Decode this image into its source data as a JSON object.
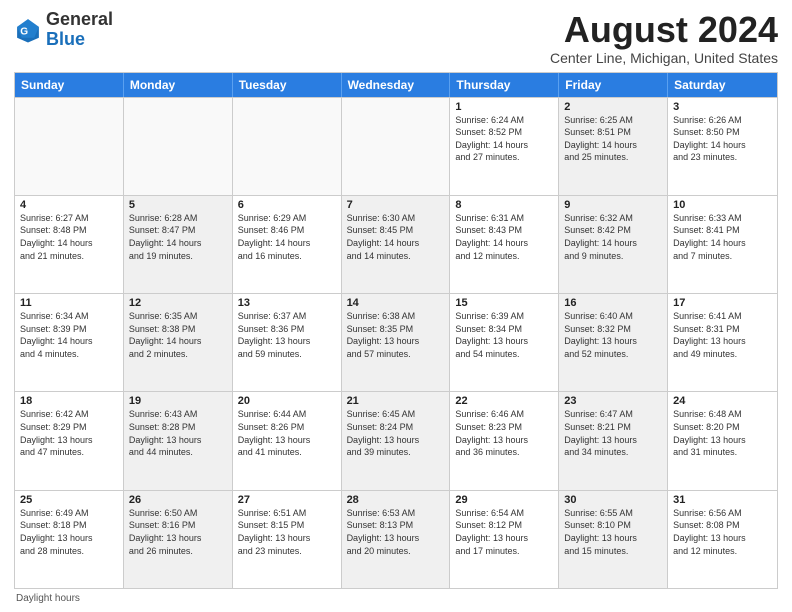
{
  "header": {
    "logo_general": "General",
    "logo_blue": "Blue",
    "month_year": "August 2024",
    "location": "Center Line, Michigan, United States"
  },
  "weekdays": [
    "Sunday",
    "Monday",
    "Tuesday",
    "Wednesday",
    "Thursday",
    "Friday",
    "Saturday"
  ],
  "rows": [
    [
      {
        "day": "",
        "info": "",
        "shaded": false,
        "empty": true
      },
      {
        "day": "",
        "info": "",
        "shaded": false,
        "empty": true
      },
      {
        "day": "",
        "info": "",
        "shaded": false,
        "empty": true
      },
      {
        "day": "",
        "info": "",
        "shaded": false,
        "empty": true
      },
      {
        "day": "1",
        "info": "Sunrise: 6:24 AM\nSunset: 8:52 PM\nDaylight: 14 hours\nand 27 minutes.",
        "shaded": false,
        "empty": false
      },
      {
        "day": "2",
        "info": "Sunrise: 6:25 AM\nSunset: 8:51 PM\nDaylight: 14 hours\nand 25 minutes.",
        "shaded": true,
        "empty": false
      },
      {
        "day": "3",
        "info": "Sunrise: 6:26 AM\nSunset: 8:50 PM\nDaylight: 14 hours\nand 23 minutes.",
        "shaded": false,
        "empty": false
      }
    ],
    [
      {
        "day": "4",
        "info": "Sunrise: 6:27 AM\nSunset: 8:48 PM\nDaylight: 14 hours\nand 21 minutes.",
        "shaded": false,
        "empty": false
      },
      {
        "day": "5",
        "info": "Sunrise: 6:28 AM\nSunset: 8:47 PM\nDaylight: 14 hours\nand 19 minutes.",
        "shaded": true,
        "empty": false
      },
      {
        "day": "6",
        "info": "Sunrise: 6:29 AM\nSunset: 8:46 PM\nDaylight: 14 hours\nand 16 minutes.",
        "shaded": false,
        "empty": false
      },
      {
        "day": "7",
        "info": "Sunrise: 6:30 AM\nSunset: 8:45 PM\nDaylight: 14 hours\nand 14 minutes.",
        "shaded": true,
        "empty": false
      },
      {
        "day": "8",
        "info": "Sunrise: 6:31 AM\nSunset: 8:43 PM\nDaylight: 14 hours\nand 12 minutes.",
        "shaded": false,
        "empty": false
      },
      {
        "day": "9",
        "info": "Sunrise: 6:32 AM\nSunset: 8:42 PM\nDaylight: 14 hours\nand 9 minutes.",
        "shaded": true,
        "empty": false
      },
      {
        "day": "10",
        "info": "Sunrise: 6:33 AM\nSunset: 8:41 PM\nDaylight: 14 hours\nand 7 minutes.",
        "shaded": false,
        "empty": false
      }
    ],
    [
      {
        "day": "11",
        "info": "Sunrise: 6:34 AM\nSunset: 8:39 PM\nDaylight: 14 hours\nand 4 minutes.",
        "shaded": false,
        "empty": false
      },
      {
        "day": "12",
        "info": "Sunrise: 6:35 AM\nSunset: 8:38 PM\nDaylight: 14 hours\nand 2 minutes.",
        "shaded": true,
        "empty": false
      },
      {
        "day": "13",
        "info": "Sunrise: 6:37 AM\nSunset: 8:36 PM\nDaylight: 13 hours\nand 59 minutes.",
        "shaded": false,
        "empty": false
      },
      {
        "day": "14",
        "info": "Sunrise: 6:38 AM\nSunset: 8:35 PM\nDaylight: 13 hours\nand 57 minutes.",
        "shaded": true,
        "empty": false
      },
      {
        "day": "15",
        "info": "Sunrise: 6:39 AM\nSunset: 8:34 PM\nDaylight: 13 hours\nand 54 minutes.",
        "shaded": false,
        "empty": false
      },
      {
        "day": "16",
        "info": "Sunrise: 6:40 AM\nSunset: 8:32 PM\nDaylight: 13 hours\nand 52 minutes.",
        "shaded": true,
        "empty": false
      },
      {
        "day": "17",
        "info": "Sunrise: 6:41 AM\nSunset: 8:31 PM\nDaylight: 13 hours\nand 49 minutes.",
        "shaded": false,
        "empty": false
      }
    ],
    [
      {
        "day": "18",
        "info": "Sunrise: 6:42 AM\nSunset: 8:29 PM\nDaylight: 13 hours\nand 47 minutes.",
        "shaded": false,
        "empty": false
      },
      {
        "day": "19",
        "info": "Sunrise: 6:43 AM\nSunset: 8:28 PM\nDaylight: 13 hours\nand 44 minutes.",
        "shaded": true,
        "empty": false
      },
      {
        "day": "20",
        "info": "Sunrise: 6:44 AM\nSunset: 8:26 PM\nDaylight: 13 hours\nand 41 minutes.",
        "shaded": false,
        "empty": false
      },
      {
        "day": "21",
        "info": "Sunrise: 6:45 AM\nSunset: 8:24 PM\nDaylight: 13 hours\nand 39 minutes.",
        "shaded": true,
        "empty": false
      },
      {
        "day": "22",
        "info": "Sunrise: 6:46 AM\nSunset: 8:23 PM\nDaylight: 13 hours\nand 36 minutes.",
        "shaded": false,
        "empty": false
      },
      {
        "day": "23",
        "info": "Sunrise: 6:47 AM\nSunset: 8:21 PM\nDaylight: 13 hours\nand 34 minutes.",
        "shaded": true,
        "empty": false
      },
      {
        "day": "24",
        "info": "Sunrise: 6:48 AM\nSunset: 8:20 PM\nDaylight: 13 hours\nand 31 minutes.",
        "shaded": false,
        "empty": false
      }
    ],
    [
      {
        "day": "25",
        "info": "Sunrise: 6:49 AM\nSunset: 8:18 PM\nDaylight: 13 hours\nand 28 minutes.",
        "shaded": false,
        "empty": false
      },
      {
        "day": "26",
        "info": "Sunrise: 6:50 AM\nSunset: 8:16 PM\nDaylight: 13 hours\nand 26 minutes.",
        "shaded": true,
        "empty": false
      },
      {
        "day": "27",
        "info": "Sunrise: 6:51 AM\nSunset: 8:15 PM\nDaylight: 13 hours\nand 23 minutes.",
        "shaded": false,
        "empty": false
      },
      {
        "day": "28",
        "info": "Sunrise: 6:53 AM\nSunset: 8:13 PM\nDaylight: 13 hours\nand 20 minutes.",
        "shaded": true,
        "empty": false
      },
      {
        "day": "29",
        "info": "Sunrise: 6:54 AM\nSunset: 8:12 PM\nDaylight: 13 hours\nand 17 minutes.",
        "shaded": false,
        "empty": false
      },
      {
        "day": "30",
        "info": "Sunrise: 6:55 AM\nSunset: 8:10 PM\nDaylight: 13 hours\nand 15 minutes.",
        "shaded": true,
        "empty": false
      },
      {
        "day": "31",
        "info": "Sunrise: 6:56 AM\nSunset: 8:08 PM\nDaylight: 13 hours\nand 12 minutes.",
        "shaded": false,
        "empty": false
      }
    ]
  ],
  "footer": {
    "daylight_label": "Daylight hours"
  }
}
